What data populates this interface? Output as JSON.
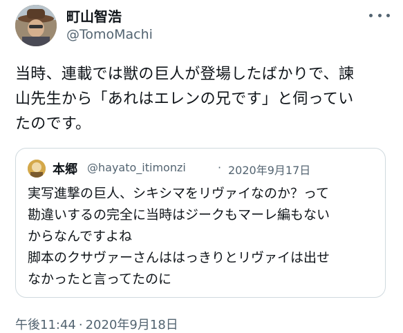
{
  "author": {
    "name": "町山智浩",
    "handle": "@TomoMachi"
  },
  "icons": {
    "more": "more-horizontal-icon"
  },
  "tweet": {
    "text": "当時、連載では獣の巨人が登場したばかりで、諫\n山先生から「あれはエレンの兄です」と伺ってい\nたのです。"
  },
  "quoted_tweet": {
    "name": "本郷",
    "handle": "@hayato_itimonzi",
    "separator": "·",
    "date": "2020年9月17日",
    "text": "実写進撃の巨人、シキシマをリヴァイなのか？って\n勘違いするの完全に当時はジークもマーレ編もない\nからなんですよね\n脚本のクサヴァーさんははっきりとリヴァイは出せ\nなかったと言ってたのに"
  },
  "timestamp": {
    "time": "午後11:44",
    "separator": "·",
    "date": "2020年9月18日"
  },
  "colors": {
    "text": "#0f1419",
    "secondary": "#536471",
    "border": "#cfd9de"
  }
}
